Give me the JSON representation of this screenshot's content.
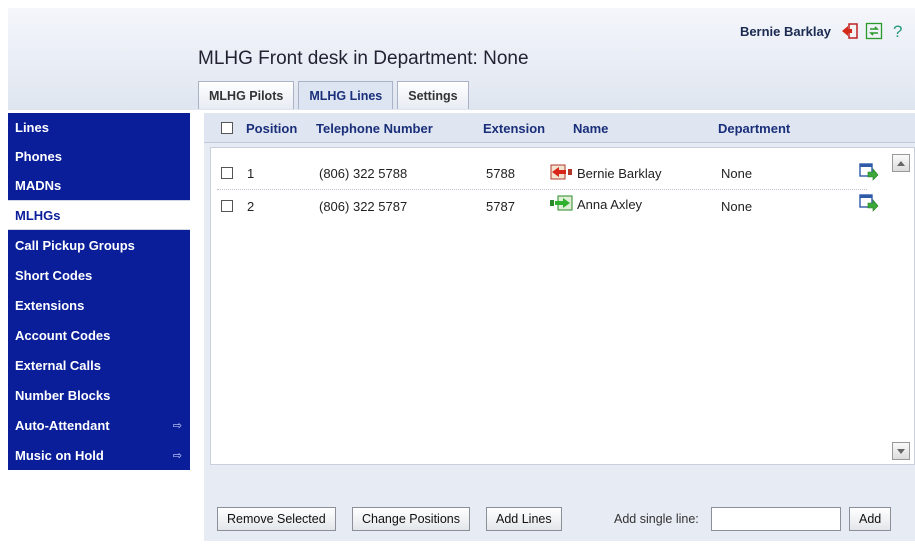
{
  "header": {
    "user_name": "Bernie Barklay",
    "title": "MLHG Front desk in Department: None",
    "icons": [
      "logout-icon",
      "refresh-icon",
      "help-icon"
    ]
  },
  "tabs": [
    {
      "label": "MLHG Pilots",
      "active": false
    },
    {
      "label": "MLHG Lines",
      "active": true
    },
    {
      "label": "Settings",
      "active": false
    }
  ],
  "sidebar": {
    "items": [
      {
        "label": "Lines"
      },
      {
        "label": "Phones"
      },
      {
        "label": "MADNs"
      },
      {
        "label": "MLHGs",
        "current": true
      },
      {
        "label": "Call Pickup Groups"
      },
      {
        "label": "Short Codes"
      },
      {
        "label": "Extensions"
      },
      {
        "label": "Account Codes"
      },
      {
        "label": "External Calls"
      },
      {
        "label": "Number Blocks"
      },
      {
        "label": "Auto-Attendant",
        "external": true
      },
      {
        "label": "Music on Hold",
        "external": true
      }
    ]
  },
  "table": {
    "columns": [
      "Position",
      "Telephone Number",
      "Extension",
      "Name",
      "Department"
    ],
    "rows": [
      {
        "position": "1",
        "phone": "(806) 322 5788",
        "extension": "5788",
        "name": "Bernie Barklay",
        "department": "None",
        "status_icon": "outgoing-red-arrow-icon"
      },
      {
        "position": "2",
        "phone": "(806) 322 5787",
        "extension": "5787",
        "name": "Anna Axley",
        "department": "None",
        "status_icon": "incoming-green-arrow-icon"
      }
    ]
  },
  "footer": {
    "remove_label": "Remove Selected",
    "change_label": "Change Positions",
    "add_lines_label": "Add Lines",
    "add_single_label": "Add single line:",
    "add_single_value": "",
    "add_label": "Add"
  },
  "colors": {
    "sidebar_bg": "#0a1e99",
    "header_text": "#1a2f7a",
    "panel_bg": "#e7ebf3"
  }
}
